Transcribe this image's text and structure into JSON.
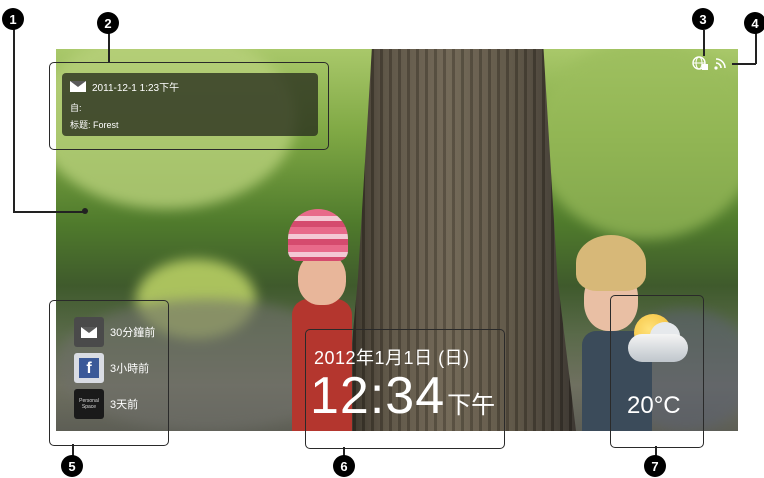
{
  "email_notification": {
    "datetime": "2011-12-1 1:23下午",
    "from_label": "自:",
    "subject_line": "标题: Forest"
  },
  "notifications": [
    {
      "icon": "mail-icon",
      "label": "30分鐘前"
    },
    {
      "icon": "facebook-icon",
      "label": "3小時前"
    },
    {
      "icon": "app-icon",
      "label": "3天前"
    }
  ],
  "clock": {
    "date": "2012年1月1日 (日)",
    "time": "12:34",
    "ampm": "下午"
  },
  "weather": {
    "temperature": "20°C",
    "icon": "partly-cloudy-icon"
  },
  "status_icons": [
    "globe-icon",
    "rss-signal-icon"
  ],
  "callouts": [
    "1",
    "2",
    "3",
    "4",
    "5",
    "6",
    "7"
  ],
  "facebook_glyph": "f",
  "app_icon_text": "Personal Space",
  "colors": {
    "accent_facebook": "#3b5998",
    "callout_bg": "#000000"
  }
}
